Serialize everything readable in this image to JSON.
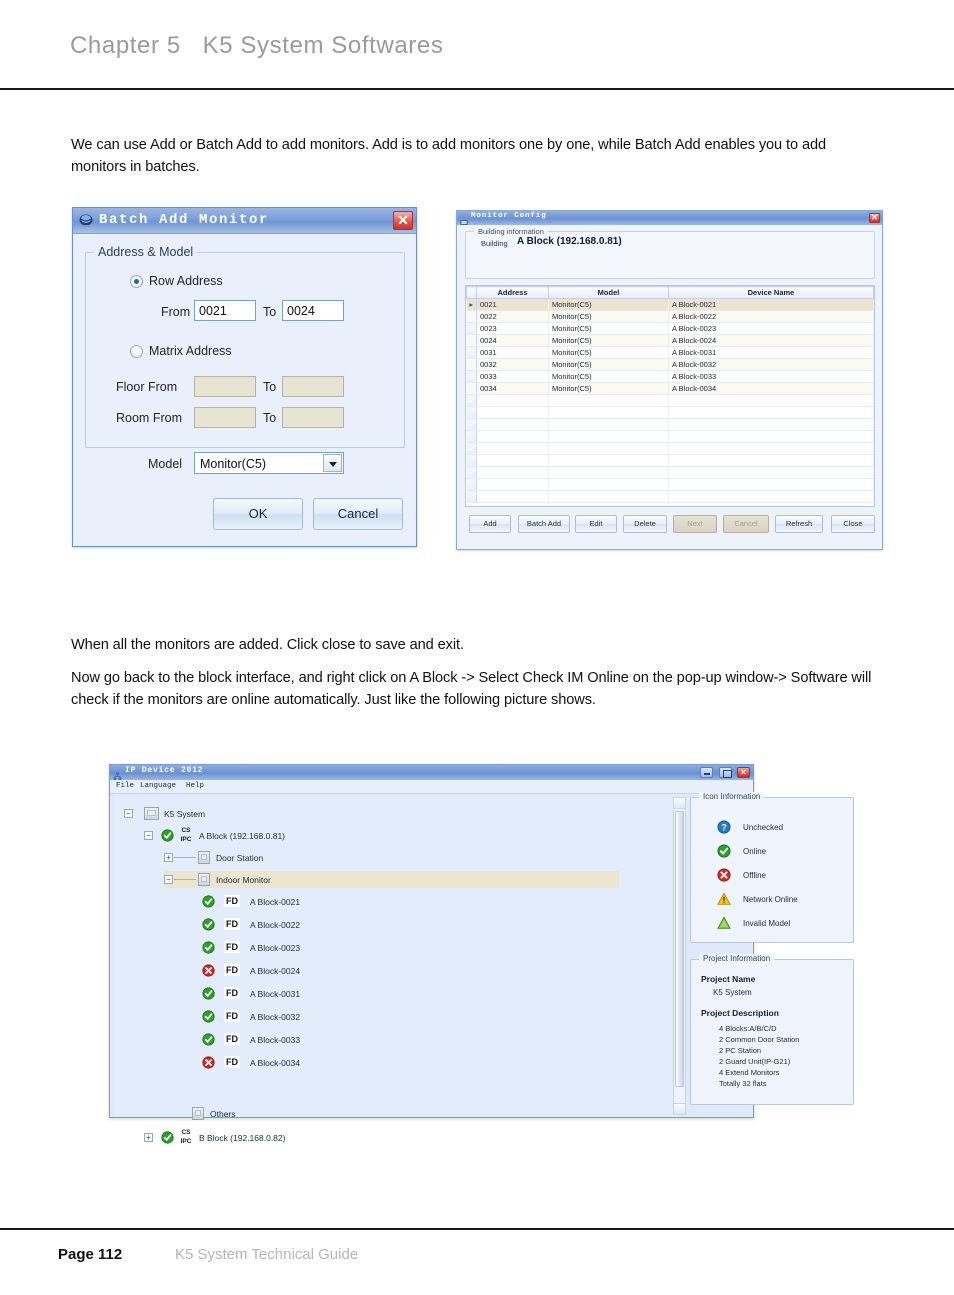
{
  "header": {
    "chapter": "Chapter 5   K5 System Softwares"
  },
  "footer": {
    "page": "Page 112",
    "guide": "K5 System Technical Guide"
  },
  "body": {
    "para1": "We can use Add or Batch Add to add monitors. Add is to add monitors one by one, while Batch Add enables you to add monitors in batches.",
    "para2": "When all the monitors are added. Click close to save and exit.",
    "para3": "Now go back to the block interface, and right click on A Block -> Select Check IM Online on the pop-up window-> Software will check if the monitors are online automatically. Just like the following picture shows."
  },
  "batch_dialog": {
    "title": "Batch Add Monitor",
    "close_label": "✕",
    "group_legend": "Address & Model",
    "row_address_label": "Row Address",
    "row_address_selected": true,
    "from_label": "From",
    "from_value": "0021",
    "to_label_1": "To",
    "to_value": "0024",
    "matrix_address_label": "Matrix Address",
    "matrix_address_selected": false,
    "floor_from_label": "Floor From",
    "floor_from_value": "",
    "floor_to_label": "To",
    "floor_to_value": "",
    "room_from_label": "Room From",
    "room_from_value": "",
    "room_to_label": "To",
    "room_to_value": "",
    "model_label": "Model",
    "model_value": "Monitor(C5)",
    "ok_label": "OK",
    "cancel_label": "Cancel"
  },
  "config_dialog": {
    "title": "Monitor Config",
    "close_label": "✕",
    "building_group_legend": "Building information",
    "building_label": "Building",
    "building_value": "A Block (192.168.0.81)",
    "columns": [
      "Address",
      "Model",
      "Device Name"
    ],
    "rows": [
      {
        "address": "0021",
        "model": "Monitor(C5)",
        "device_name": "A Block-0021"
      },
      {
        "address": "0022",
        "model": "Monitor(C5)",
        "device_name": "A Block-0022"
      },
      {
        "address": "0023",
        "model": "Monitor(C5)",
        "device_name": "A Block-0023"
      },
      {
        "address": "0024",
        "model": "Monitor(C5)",
        "device_name": "A Block-0024"
      },
      {
        "address": "0031",
        "model": "Monitor(C5)",
        "device_name": "A Block-0031"
      },
      {
        "address": "0032",
        "model": "Monitor(C5)",
        "device_name": "A Block-0032"
      },
      {
        "address": "0033",
        "model": "Monitor(C5)",
        "device_name": "A Block-0033"
      },
      {
        "address": "0034",
        "model": "Monitor(C5)",
        "device_name": "A Block-0034"
      }
    ],
    "buttons": [
      {
        "label": "Add",
        "disabled": false
      },
      {
        "label": "Batch Add",
        "disabled": false
      },
      {
        "label": "Edit",
        "disabled": false
      },
      {
        "label": "Delete",
        "disabled": false
      },
      {
        "label": "Next",
        "disabled": true
      },
      {
        "label": "Cancel",
        "disabled": true
      },
      {
        "label": "Refresh",
        "disabled": false
      },
      {
        "label": "Close",
        "disabled": false
      }
    ]
  },
  "ip_device_window": {
    "title": "IP Device 2012",
    "menus": [
      "File",
      "Language",
      "Help"
    ],
    "window_buttons": {
      "minimize": "–",
      "maximize": "□",
      "close": "✕"
    },
    "tree": {
      "root": "K5 System",
      "block_a": "A Block (192.168.0.81)",
      "block_a_badge_top": "CS",
      "block_a_badge_bottom": "IPC",
      "door_station": "Door Station",
      "indoor_monitor": "Indoor Monitor",
      "monitors": [
        {
          "label": "A Block-0021",
          "badge": "FD",
          "status": "online"
        },
        {
          "label": "A Block-0022",
          "badge": "FD",
          "status": "online"
        },
        {
          "label": "A Block-0023",
          "badge": "FD",
          "status": "online"
        },
        {
          "label": "A Block-0024",
          "badge": "FD",
          "status": "offline"
        },
        {
          "label": "A Block-0031",
          "badge": "FD",
          "status": "online"
        },
        {
          "label": "A Block-0032",
          "badge": "FD",
          "status": "online"
        },
        {
          "label": "A Block-0033",
          "badge": "FD",
          "status": "online"
        },
        {
          "label": "A Block-0034",
          "badge": "FD",
          "status": "offline"
        }
      ],
      "others": "Others",
      "block_b": "B Block (192.168.0.82)",
      "block_b_badge_top": "CS",
      "block_b_badge_bottom": "IPC"
    },
    "icon_information": {
      "legend": "Icon Information",
      "items": [
        {
          "label": "Unchecked",
          "icon": "question-blue"
        },
        {
          "label": "Online",
          "icon": "check-green"
        },
        {
          "label": "Offline",
          "icon": "cross-red"
        },
        {
          "label": "Network Online",
          "icon": "warning-yellow"
        },
        {
          "label": "Invalid Model",
          "icon": "triangle-green"
        }
      ]
    },
    "project_information": {
      "legend": "Project Information",
      "name_heading": "Project Name",
      "name_value": "K5 System",
      "description_heading": "Project Description",
      "description_lines": [
        "4 Blocks:A/B/C/D",
        "2 Common Door Station",
        "2 PC Station",
        "2 Guard Unit(IP-G21)",
        "4 Extend Monitors",
        "Totally 32 flats"
      ]
    }
  },
  "colors": {
    "title_blue": "#6f95d4",
    "online_green": "#33a02c",
    "offline_red": "#d02a24",
    "warning_yellow": "#f2c218",
    "unchecked_blue": "#1f7ec4",
    "selection_tan": "#ece5cf"
  }
}
